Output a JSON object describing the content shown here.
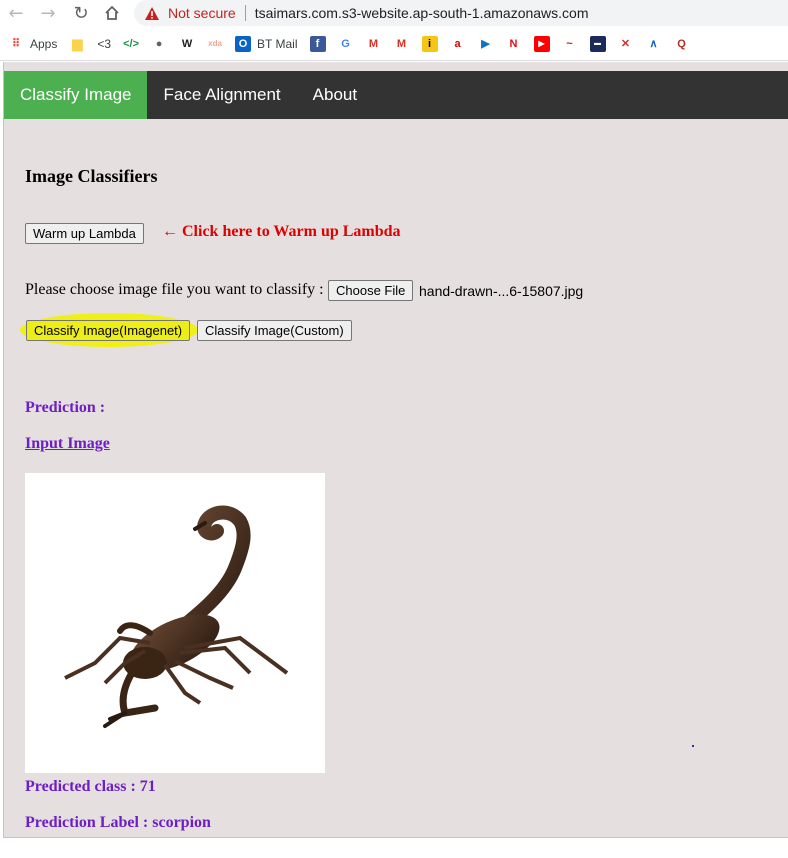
{
  "browser": {
    "security_label": "Not secure",
    "url": "tsaimars.com.s3-website.ap-south-1.amazonaws.com",
    "bookmarks": [
      {
        "label": "Apps",
        "icon": "apps-grid-icon",
        "color": "#ea4335"
      },
      {
        "label": "",
        "icon": "folder-icon",
        "color": "#f9d34b"
      },
      {
        "label": "<3",
        "icon": "text-icon",
        "color": "#3c4043"
      },
      {
        "label": "",
        "icon": "code-icon",
        "color": "#1e8e3e"
      },
      {
        "label": "",
        "icon": "globe-icon",
        "color": "#5f6368"
      },
      {
        "label": "",
        "icon": "wikipedia-icon",
        "color": "#202124"
      },
      {
        "label": "",
        "icon": "xda-icon",
        "color": "#f4a38d"
      },
      {
        "label": "BT Mail",
        "icon": "outlook-icon",
        "color": "#0a64c8"
      },
      {
        "label": "",
        "icon": "facebook-icon",
        "color": "#3b5998"
      },
      {
        "label": "",
        "icon": "google-icon",
        "color": "#4285f4"
      },
      {
        "label": "",
        "icon": "gmail-icon",
        "color": "#d93025"
      },
      {
        "label": "",
        "icon": "gmail-icon",
        "color": "#d93025"
      },
      {
        "label": "",
        "icon": "imdb-icon",
        "color": "#f5c518"
      },
      {
        "label": "",
        "icon": "airtel-icon",
        "color": "#e40000"
      },
      {
        "label": "",
        "icon": "play-icon",
        "color": "#0d74bd"
      },
      {
        "label": "",
        "icon": "netflix-icon",
        "color": "#e50914"
      },
      {
        "label": "",
        "icon": "youtube-icon",
        "color": "#ff0000"
      },
      {
        "label": "",
        "icon": "swirl-icon",
        "color": "#d2141e"
      },
      {
        "label": "",
        "icon": "news-icon",
        "color": "#1a2b5c"
      },
      {
        "label": "",
        "icon": "cross-icon",
        "color": "#d32f2f"
      },
      {
        "label": "",
        "icon": "afc-icon",
        "color": "#1565c0"
      },
      {
        "label": "",
        "icon": "quora-icon",
        "color": "#b92b27"
      }
    ]
  },
  "nav": {
    "items": [
      "Classify Image",
      "Face Alignment",
      "About"
    ],
    "active_color": "#4caf50"
  },
  "content": {
    "title": "Image Classifiers",
    "warm_button": "Warm up Lambda",
    "warm_hint": "← Click here to Warm up Lambda",
    "choose_label": "Please choose image file you want to classify :",
    "choose_button": "Choose File",
    "file_name": "hand-drawn-...6-15807.jpg",
    "classify_imagenet": "Classify Image(Imagenet)",
    "classify_custom": "Classify Image(Custom)",
    "prediction_label": "Prediction :",
    "input_image_label": "Input Image",
    "predicted_class": "Predicted class : 71",
    "prediction_label_text": "Prediction Label : scorpion"
  }
}
